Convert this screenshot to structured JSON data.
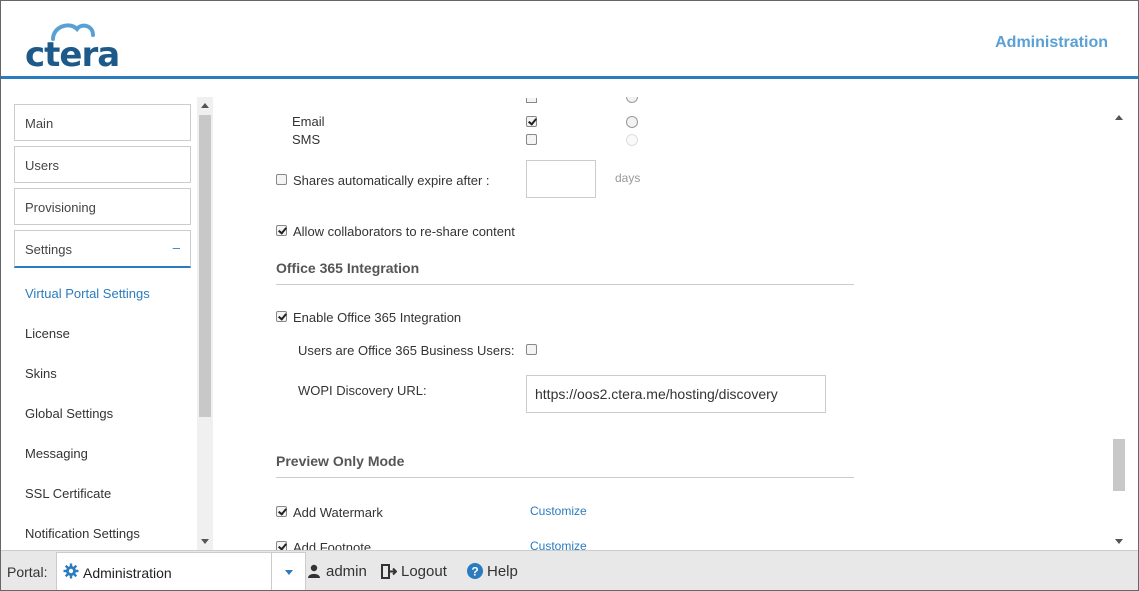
{
  "header": {
    "logo_text": "ctera",
    "title": "Administration",
    "accent_color": "#2b7bbf"
  },
  "sidebar": {
    "boxes": [
      {
        "label": "Main"
      },
      {
        "label": "Users"
      },
      {
        "label": "Provisioning"
      },
      {
        "label": "Settings",
        "toggle": "–"
      }
    ],
    "sub_items": [
      {
        "label": "Virtual Portal Settings",
        "selected": true
      },
      {
        "label": "License"
      },
      {
        "label": "Skins"
      },
      {
        "label": "Global Settings"
      },
      {
        "label": "Messaging"
      },
      {
        "label": "SSL Certificate"
      },
      {
        "label": "Notification Settings"
      }
    ]
  },
  "main": {
    "notify": {
      "email_label": "Email",
      "sms_label": "SMS"
    },
    "expire": {
      "label": "Shares automatically expire after :",
      "value": "",
      "unit": "days"
    },
    "reshare": {
      "label": "Allow collaborators to re-share content"
    },
    "office365": {
      "title": "Office 365 Integration",
      "enable_label": "Enable Office 365 Integration",
      "business_label": "Users are Office 365 Business Users:",
      "wopi_label": "WOPI Discovery URL:",
      "wopi_value": "https://oos2.ctera.me/hosting/discovery"
    },
    "preview": {
      "title": "Preview Only Mode",
      "watermark_label": "Add Watermark",
      "footnote_label": "Add Footnote",
      "customize_label": "Customize"
    }
  },
  "footer": {
    "portal_label": "Portal:",
    "portal_value": "Administration",
    "user": "admin",
    "logout": "Logout",
    "help": "Help"
  }
}
